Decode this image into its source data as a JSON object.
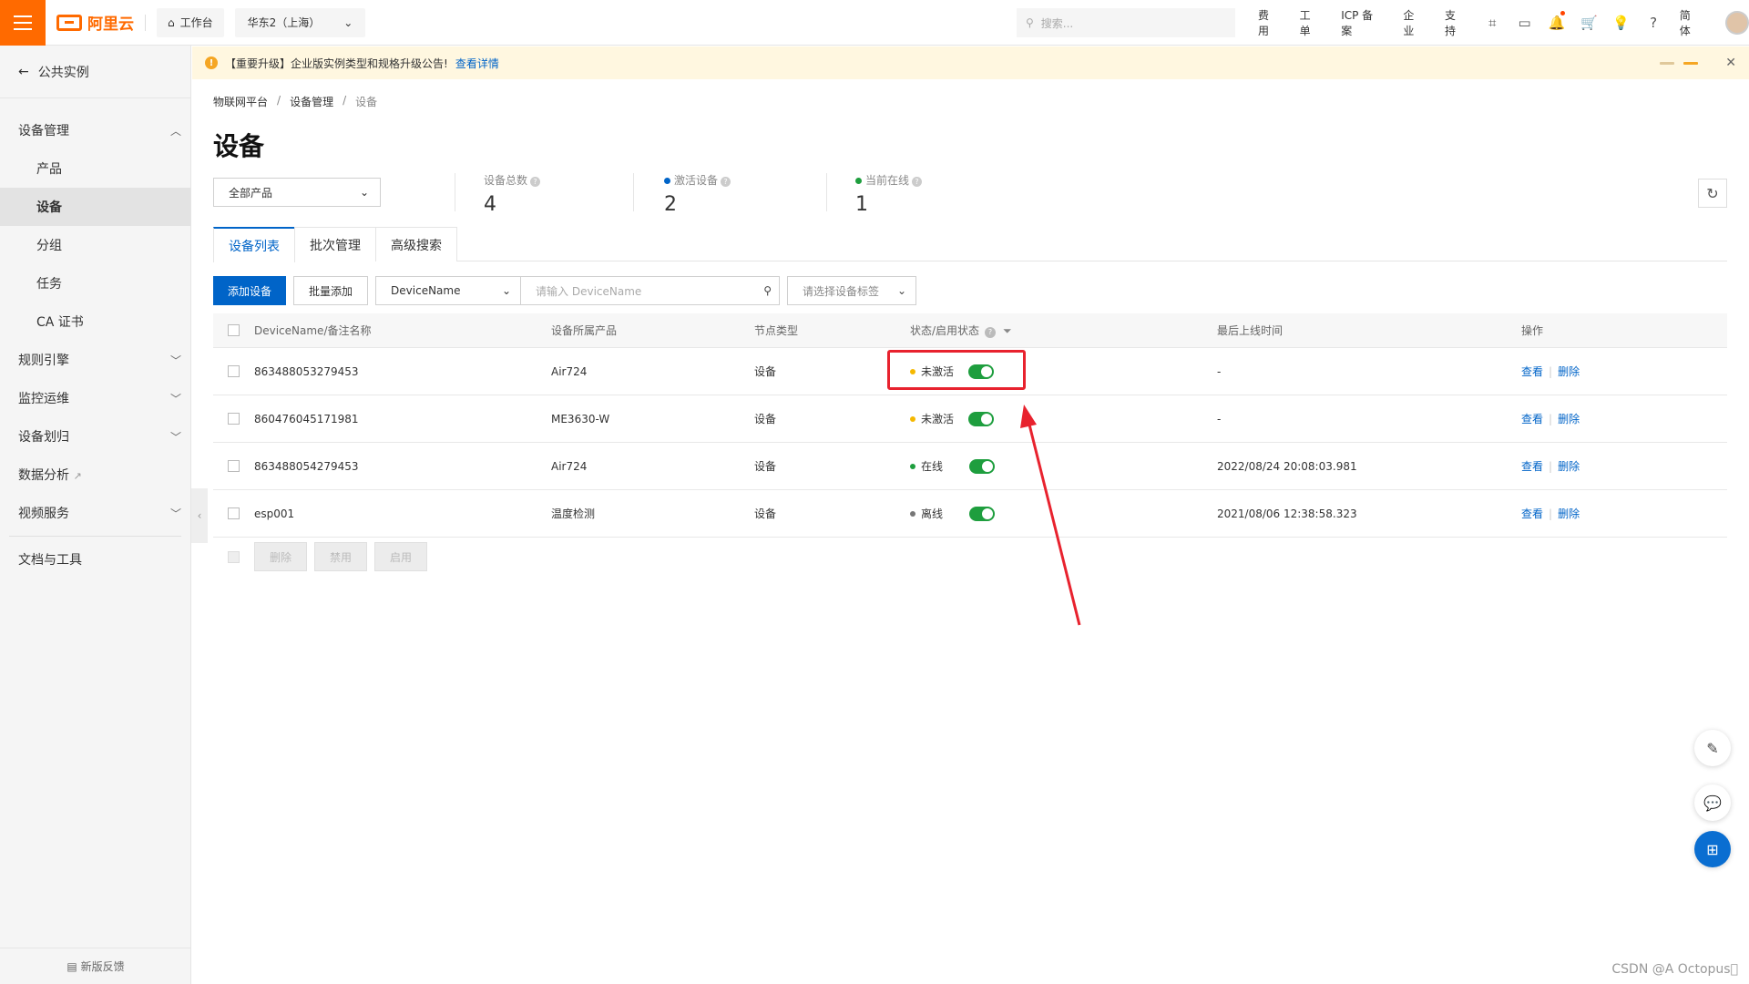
{
  "topbar": {
    "logo": "阿里云",
    "workbench": "工作台",
    "region": "华东2（上海）",
    "search_placeholder": "搜索...",
    "links": [
      "费用",
      "工单",
      "ICP 备案",
      "企业",
      "支持"
    ],
    "lang": "简体"
  },
  "sidebar": {
    "back": "公共实例",
    "group_device": "设备管理",
    "items": [
      "产品",
      "设备",
      "分组",
      "任务",
      "CA 证书"
    ],
    "rules": "规则引擎",
    "monitor": "监控运维",
    "transfer": "设备划归",
    "analytics": "数据分析",
    "video": "视频服务",
    "docs": "文档与工具",
    "feedback": "新版反馈"
  },
  "notice": {
    "text": "【重要升级】企业版实例类型和规格升级公告!",
    "link": "查看详情"
  },
  "breadcrumb": [
    "物联网平台",
    "设备管理",
    "设备"
  ],
  "page_title": "设备",
  "product_filter": "全部产品",
  "stats": {
    "total_label": "设备总数",
    "total": "4",
    "active_label": "激活设备",
    "active": "2",
    "online_label": "当前在线",
    "online": "1"
  },
  "tabs": [
    "设备列表",
    "批次管理",
    "高级搜索"
  ],
  "toolbar": {
    "add": "添加设备",
    "batch_add": "批量添加",
    "field": "DeviceName",
    "input_placeholder": "请输入 DeviceName",
    "tag_placeholder": "请选择设备标签"
  },
  "table": {
    "headers": [
      "DeviceName/备注名称",
      "设备所属产品",
      "节点类型",
      "状态/启用状态",
      "最后上线时间",
      "操作"
    ],
    "rows": [
      {
        "name": "863488053279453",
        "product": "Air724",
        "node": "设备",
        "status": "未激活",
        "last": "-"
      },
      {
        "name": "860476045171981",
        "product": "ME3630-W",
        "node": "设备",
        "status": "未激活",
        "last": "-"
      },
      {
        "name": "863488054279453",
        "product": "Air724",
        "node": "设备",
        "status": "在线",
        "last": "2022/08/24 20:08:03.981"
      },
      {
        "name": "esp001",
        "product": "温度检测",
        "node": "设备",
        "status": "离线",
        "last": "2021/08/06 12:38:58.323"
      }
    ],
    "op_view": "查看",
    "op_delete": "删除"
  },
  "bulk": [
    "删除",
    "禁用",
    "启用"
  ],
  "watermark": "CSDN @A   Octopus\u0000",
  "colors": {
    "accent": "#0064c8",
    "brand": "#ff6a00",
    "inactive": "#f5b800",
    "online": "#1e9e3e",
    "offline": "#777777",
    "annotation": "#e8222e"
  }
}
